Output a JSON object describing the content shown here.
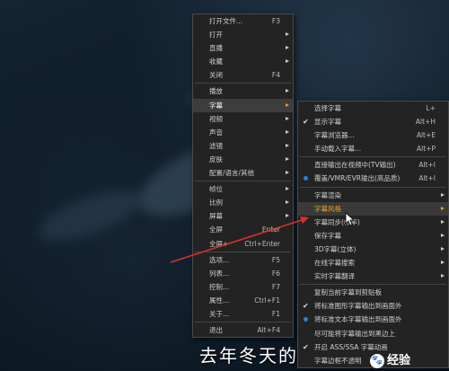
{
  "main_menu": [
    {
      "label": "打开文件...",
      "shortcut": "F3"
    },
    {
      "label": "打开",
      "submenu": true
    },
    {
      "label": "直播",
      "submenu": true
    },
    {
      "label": "收藏",
      "submenu": true
    },
    {
      "label": "关闭",
      "shortcut": "F4"
    },
    {
      "sep": true
    },
    {
      "label": "播放",
      "submenu": true
    },
    {
      "label": "字幕",
      "submenu": true,
      "active": true
    },
    {
      "label": "视频",
      "submenu": true
    },
    {
      "label": "声音",
      "submenu": true
    },
    {
      "label": "滤镜",
      "submenu": true
    },
    {
      "label": "皮肤",
      "submenu": true
    },
    {
      "label": "配置/语言/其他",
      "submenu": true
    },
    {
      "sep": true
    },
    {
      "label": "帧位",
      "submenu": true
    },
    {
      "label": "比例",
      "submenu": true
    },
    {
      "label": "屏幕",
      "submenu": true
    },
    {
      "label": "全屏",
      "shortcut": "Enter"
    },
    {
      "label": "全屏+",
      "shortcut": "Ctrl+Enter"
    },
    {
      "sep": true
    },
    {
      "label": "选项...",
      "shortcut": "F5"
    },
    {
      "label": "列表...",
      "shortcut": "F6"
    },
    {
      "label": "控制...",
      "shortcut": "F7"
    },
    {
      "label": "属性...",
      "shortcut": "Ctrl+F1"
    },
    {
      "label": "关于...",
      "shortcut": "F1"
    },
    {
      "sep": true
    },
    {
      "label": "退出",
      "shortcut": "Alt+F4"
    }
  ],
  "sub_menu": [
    {
      "label": "选择字幕",
      "shortcut": "L+"
    },
    {
      "label": "显示字幕",
      "shortcut": "Alt+H",
      "checked": true
    },
    {
      "label": "字幕浏览器...",
      "shortcut": "Alt+E"
    },
    {
      "label": "手动载入字幕...",
      "shortcut": "Alt+P"
    },
    {
      "sep": true
    },
    {
      "label": "直接输出在视频中(TV输出)",
      "shortcut": "Alt+I"
    },
    {
      "label": "覆盖/VMR/EVR输出(高品质)",
      "shortcut": "Alt+I",
      "radio": true
    },
    {
      "sep": true
    },
    {
      "label": "字幕渲染",
      "submenu": true
    },
    {
      "label": "字幕风格",
      "submenu": true,
      "active": true
    },
    {
      "label": "字幕同步(帧率)",
      "submenu": true
    },
    {
      "label": "保存字幕",
      "submenu": true
    },
    {
      "label": "3D字幕(立体)",
      "submenu": true
    },
    {
      "label": "在线字幕搜索",
      "submenu": true
    },
    {
      "label": "实时字幕翻译",
      "submenu": true
    },
    {
      "sep": true
    },
    {
      "label": "复制当前字幕到剪贴板"
    },
    {
      "label": "将标准图形字幕输出到画面外",
      "checked": true
    },
    {
      "label": "将标准文本字幕输出到画面外",
      "radio": true
    },
    {
      "label": "尽可能将字幕输出到黑边上"
    },
    {
      "label": "开启 ASS/SSA 字幕动画",
      "checked": true
    },
    {
      "label": "字幕边框不透明"
    }
  ],
  "subtitle_text": "去年冬天的",
  "watermark": {
    "icon": "🐾",
    "text": "经验"
  },
  "colors": {
    "accent": "#f0a020",
    "radio": "#2f7de0",
    "arrow": "#d9302a"
  }
}
